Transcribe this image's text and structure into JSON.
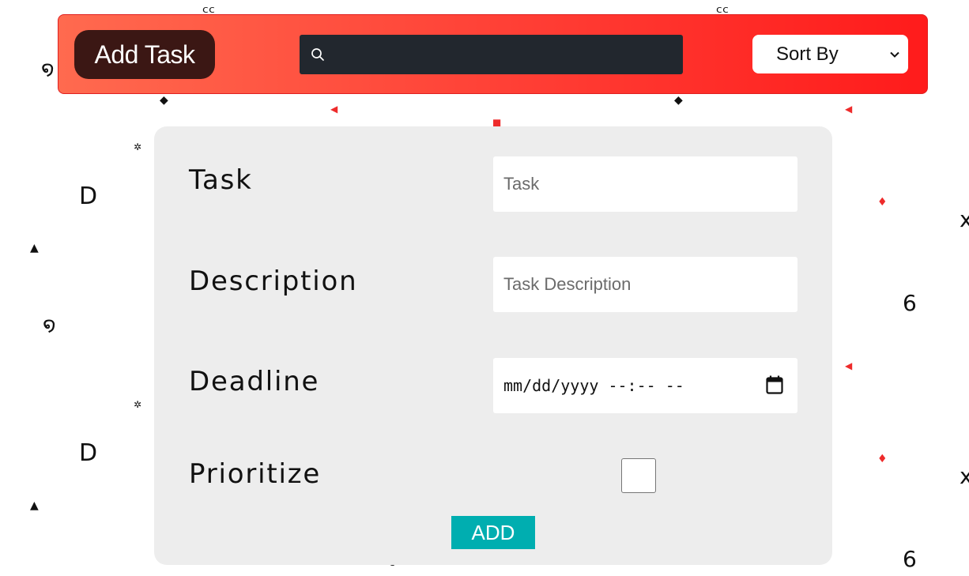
{
  "header": {
    "add_task_label": "Add Task",
    "search": {
      "value": "",
      "placeholder": "",
      "icon": "search-icon"
    },
    "sort": {
      "selected": "Sort By",
      "icon": "chevron-down-icon"
    },
    "gradient_start": "#ff6a4f",
    "gradient_end": "#ff1b1b",
    "button_bg": "#3b1714"
  },
  "form": {
    "fields": [
      {
        "label": "Task",
        "placeholder": "Task",
        "value": ""
      },
      {
        "label": "Description",
        "placeholder": "Task Description",
        "value": ""
      },
      {
        "label": "Deadline",
        "value": "mm/dd/yyyy --:-- --",
        "icon": "calendar-icon"
      },
      {
        "label": "Prioritize",
        "checked": false
      }
    ],
    "submit_label": "ADD",
    "submit_color": "#00aeb0",
    "card_bg": "#ededed"
  },
  "background": {
    "accent_red": "#ee2b2b",
    "decoration_color": "#111111"
  }
}
